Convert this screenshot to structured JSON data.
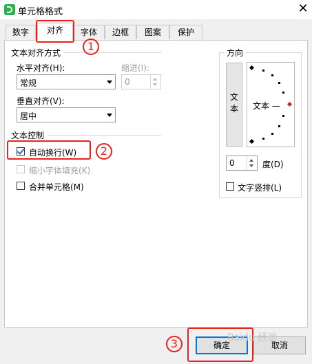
{
  "window": {
    "title": "单元格格式",
    "close_glyph": "✕"
  },
  "tabs": [
    {
      "label": "数字",
      "active": false
    },
    {
      "label": "对齐",
      "active": true
    },
    {
      "label": "字体",
      "active": false
    },
    {
      "label": "边框",
      "active": false
    },
    {
      "label": "图案",
      "active": false
    },
    {
      "label": "保护",
      "active": false
    }
  ],
  "alignment": {
    "group_label": "文本对齐方式",
    "horizontal_label": "水平对齐(H):",
    "horizontal_value": "常规",
    "indent_label": "缩进(I):",
    "indent_value": "0",
    "vertical_label": "垂直对齐(V):",
    "vertical_value": "居中"
  },
  "text_control": {
    "group_label": "文本控制",
    "wrap_text": {
      "label": "自动换行(W)",
      "checked": true
    },
    "shrink_to_fit": {
      "label": "缩小字体填充(K)",
      "checked": false,
      "disabled": true
    },
    "merge_cells": {
      "label": "合并单元格(M)",
      "checked": false
    }
  },
  "orientation": {
    "group_label": "方向",
    "vertical_text_button": "文本",
    "dial_text": "文本 —",
    "degree_value": "0",
    "degree_label": "度(D)",
    "vertical_text_checkbox": {
      "label": "文字竖排(L)",
      "checked": false
    }
  },
  "buttons": {
    "ok": "确定",
    "cancel": "取消"
  },
  "annotations": {
    "n1": "1",
    "n2": "2",
    "n3": "3"
  },
  "watermark": "Baidu 经验",
  "colors": {
    "highlight": "#e8221e",
    "primary_border": "#0078d7",
    "check": "#1a6ed8"
  }
}
